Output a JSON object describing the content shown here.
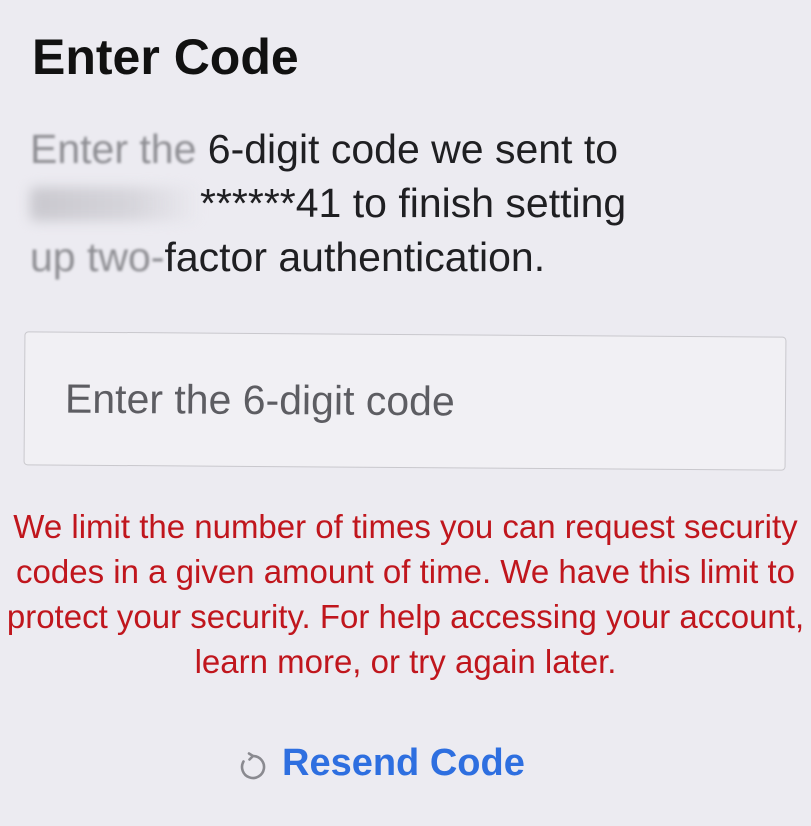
{
  "header": {
    "title": "Enter Code"
  },
  "description": {
    "prefix_faded": "Enter the",
    "text_part1": " 6-digit code we sent to",
    "masked_number": "******41",
    "text_part2": " to finish setting",
    "suffix_faded": "up two-",
    "text_part3": "factor authentication."
  },
  "code_input": {
    "placeholder": "Enter the 6-digit code",
    "value": ""
  },
  "warning": {
    "text": "We limit the number of times you can request security codes in a given amount of time. We have this limit to protect your security. For help accessing your account,  learn more, or try again later."
  },
  "resend": {
    "label": "Resend Code",
    "icon": "refresh-icon"
  },
  "colors": {
    "warning": "#c0161d",
    "link": "#2e6fe0",
    "background": "#ecebf1"
  }
}
